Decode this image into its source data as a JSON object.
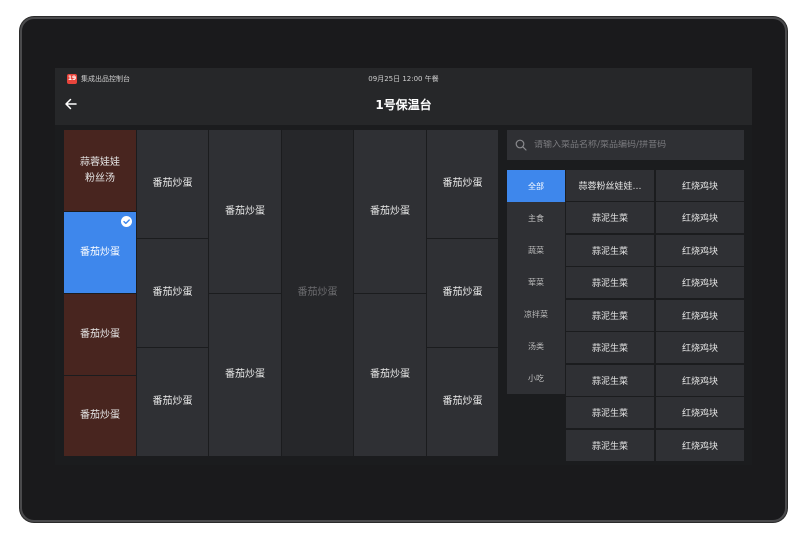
{
  "statusbar": {
    "app_icon_text": "19",
    "app_name": "集成出品控制台",
    "datetime": "09月25日 12:00 午餐"
  },
  "header": {
    "title": "1号保温台"
  },
  "grid": {
    "col1": [
      {
        "label": "蒜蓉娃娃\n粉丝汤",
        "state": "red"
      },
      {
        "label": "番茄炒蛋",
        "state": "selected"
      },
      {
        "label": "番茄炒蛋",
        "state": "red"
      },
      {
        "label": "番茄炒蛋",
        "state": "red"
      }
    ],
    "col2": [
      "番茄炒蛋",
      "番茄炒蛋",
      "番茄炒蛋"
    ],
    "col3": [
      "番茄炒蛋",
      "番茄炒蛋"
    ],
    "col4": [
      "番茄炒蛋"
    ],
    "col5": [
      "番茄炒蛋",
      "番茄炒蛋"
    ],
    "col6": [
      "番茄炒蛋",
      "番茄炒蛋",
      "番茄炒蛋"
    ]
  },
  "search": {
    "placeholder": "请输入菜品名称/菜品编码/拼音码"
  },
  "categories": [
    "全部",
    "主食",
    "蔬菜",
    "荤菜",
    "凉拌菜",
    "汤类",
    "小吃"
  ],
  "dishes": [
    [
      "蒜蓉粉丝娃娃…",
      "红烧鸡块"
    ],
    [
      "蒜泥生菜",
      "红烧鸡块"
    ],
    [
      "蒜泥生菜",
      "红烧鸡块"
    ],
    [
      "蒜泥生菜",
      "红烧鸡块"
    ],
    [
      "蒜泥生菜",
      "红烧鸡块"
    ],
    [
      "蒜泥生菜",
      "红烧鸡块"
    ],
    [
      "蒜泥生菜",
      "红烧鸡块"
    ],
    [
      "蒜泥生菜",
      "红烧鸡块"
    ],
    [
      "蒜泥生菜",
      "红烧鸡块"
    ]
  ],
  "colors": {
    "accent": "#3e87ec",
    "slot_red": "#48251f",
    "cell": "#2f3034"
  }
}
